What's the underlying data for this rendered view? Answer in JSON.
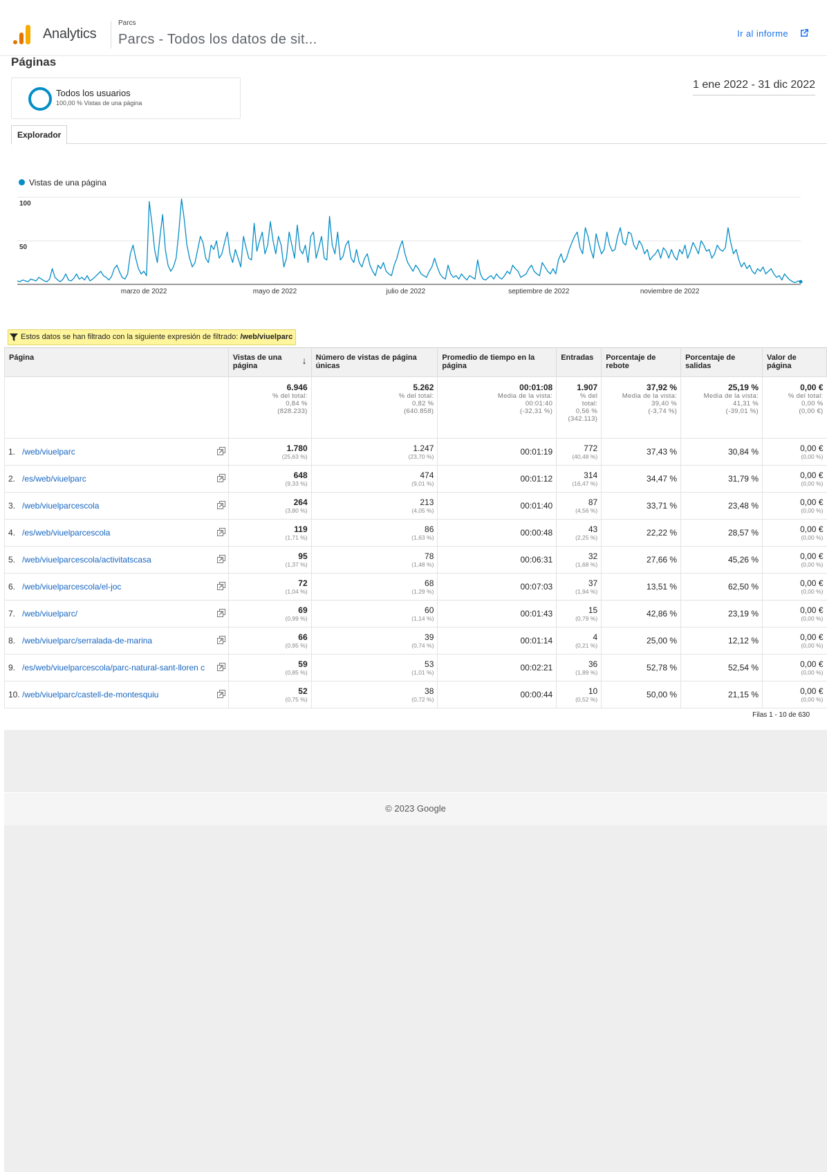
{
  "header": {
    "app_name": "Analytics",
    "property_small": "Parcs",
    "property_title": "Parcs - Todos los datos de sit...",
    "goto_report": "Ir al informe"
  },
  "page": {
    "title": "Páginas",
    "segment_name": "Todos los usuarios",
    "segment_sub": "100,00 % Vistas de una página",
    "date_range": "1 ene 2022 - 31 dic 2022",
    "tab_explorer": "Explorador"
  },
  "chart_data": {
    "type": "line",
    "series": [
      {
        "name": "Vistas de una página",
        "color": "#058dc7",
        "values": [
          4,
          3,
          5,
          4,
          3,
          6,
          5,
          4,
          8,
          6,
          4,
          3,
          6,
          18,
          8,
          5,
          3,
          6,
          12,
          5,
          4,
          7,
          12,
          6,
          8,
          5,
          10,
          4,
          6,
          9,
          12,
          15,
          10,
          8,
          5,
          9,
          18,
          22,
          14,
          8,
          6,
          12,
          35,
          45,
          30,
          18,
          12,
          15,
          10,
          95,
          70,
          40,
          25,
          55,
          80,
          40,
          22,
          15,
          20,
          30,
          60,
          98,
          75,
          45,
          30,
          20,
          25,
          40,
          55,
          48,
          30,
          25,
          45,
          40,
          50,
          30,
          35,
          48,
          60,
          35,
          25,
          40,
          30,
          20,
          55,
          42,
          30,
          28,
          70,
          38,
          50,
          60,
          35,
          45,
          72,
          50,
          35,
          55,
          45,
          20,
          30,
          60,
          45,
          30,
          68,
          40,
          35,
          45,
          25,
          55,
          60,
          30,
          42,
          55,
          30,
          28,
          78,
          45,
          35,
          60,
          28,
          32,
          45,
          50,
          30,
          25,
          40,
          25,
          20,
          30,
          35,
          22,
          15,
          10,
          22,
          18,
          25,
          15,
          12,
          10,
          22,
          30,
          42,
          50,
          35,
          25,
          20,
          15,
          22,
          18,
          12,
          10,
          8,
          15,
          20,
          30,
          20,
          12,
          8,
          6,
          22,
          12,
          8,
          10,
          6,
          12,
          8,
          5,
          10,
          8,
          6,
          28,
          12,
          6,
          5,
          8,
          10,
          6,
          12,
          8,
          6,
          10,
          15,
          12,
          22,
          18,
          15,
          8,
          10,
          12,
          18,
          22,
          15,
          12,
          10,
          25,
          20,
          15,
          12,
          18,
          12,
          28,
          35,
          25,
          30,
          40,
          48,
          55,
          60,
          42,
          35,
          65,
          55,
          40,
          30,
          58,
          45,
          35,
          40,
          60,
          45,
          38,
          40,
          55,
          65,
          48,
          45,
          60,
          58,
          45,
          40,
          50,
          45,
          35,
          40,
          28,
          32,
          35,
          40,
          30,
          42,
          38,
          30,
          40,
          32,
          28,
          40,
          35,
          45,
          30,
          38,
          48,
          42,
          35,
          50,
          45,
          38,
          40,
          30,
          35,
          45,
          40,
          38,
          42,
          65,
          48,
          35,
          40,
          28,
          20,
          25,
          18,
          22,
          15,
          12,
          18,
          15,
          20,
          12,
          15,
          18,
          12,
          8,
          10,
          5,
          12,
          8,
          5,
          3,
          2,
          4,
          3
        ]
      }
    ],
    "x_labels": [
      "marzo de 2022",
      "mayo de 2022",
      "julio de 2022",
      "septiembre de 2022",
      "noviembre de 2022"
    ],
    "y_ticks": [
      "100",
      "50"
    ],
    "ylim": [
      0,
      100
    ],
    "grid": true,
    "legend": "top-left"
  },
  "filter": {
    "text": "Estos datos se han filtrado con la siguiente expresión de filtrado:",
    "expression": "/web/viuelparc"
  },
  "table": {
    "headers": {
      "page": "Página",
      "views": "Vistas de una página",
      "unique": "Número de vistas de página únicas",
      "avg_time": "Promedio de tiempo en la página",
      "entries": "Entradas",
      "bounce": "Porcentaje de rebote",
      "exits": "Porcentaje de salidas",
      "value": "Valor de página"
    },
    "totals": {
      "views": {
        "main": "6.946",
        "l1": "% del total:",
        "l2": "0,84 %",
        "l3": "(828.233)"
      },
      "unique": {
        "main": "5.262",
        "l1": "% del total:",
        "l2": "0,82 %",
        "l3": "(640.858)"
      },
      "avg_time": {
        "main": "00:01:08",
        "l1": "Media de la vista:",
        "l2": "00:01:40",
        "l3": "(-32,31 %)"
      },
      "entries": {
        "main": "1.907",
        "l1": "% del",
        "l2": "total:",
        "l3": "0,56 %",
        "l4": "(342.113)"
      },
      "bounce": {
        "main": "37,92 %",
        "l1": "Media de la vista:",
        "l2": "39,40 %",
        "l3": "(-3,74 %)"
      },
      "exits": {
        "main": "25,19 %",
        "l1": "Media de la vista:",
        "l2": "41,31 %",
        "l3": "(-39,01 %)"
      },
      "value": {
        "main": "0,00 €",
        "l1": "% del total:",
        "l2": "0,00 %",
        "l3": "(0,00 €)"
      }
    },
    "rows": [
      {
        "rank": "1.",
        "page": "/web/viuelparc",
        "views": "1.780",
        "views_pct": "(25,63 %)",
        "unique": "1.247",
        "unique_pct": "(23,70 %)",
        "avg_time": "00:01:19",
        "entries": "772",
        "entries_pct": "(40,48 %)",
        "bounce": "37,43 %",
        "exits": "30,84 %",
        "value": "0,00 €",
        "value_pct": "(0,00 %)"
      },
      {
        "rank": "2.",
        "page": "/es/web/viuelparc",
        "views": "648",
        "views_pct": "(9,33 %)",
        "unique": "474",
        "unique_pct": "(9,01 %)",
        "avg_time": "00:01:12",
        "entries": "314",
        "entries_pct": "(16,47 %)",
        "bounce": "34,47 %",
        "exits": "31,79 %",
        "value": "0,00 €",
        "value_pct": "(0,00 %)"
      },
      {
        "rank": "3.",
        "page": "/web/viuelparcescola",
        "views": "264",
        "views_pct": "(3,80 %)",
        "unique": "213",
        "unique_pct": "(4,05 %)",
        "avg_time": "00:01:40",
        "entries": "87",
        "entries_pct": "(4,56 %)",
        "bounce": "33,71 %",
        "exits": "23,48 %",
        "value": "0,00 €",
        "value_pct": "(0,00 %)"
      },
      {
        "rank": "4.",
        "page": "/es/web/viuelparcescola",
        "views": "119",
        "views_pct": "(1,71 %)",
        "unique": "86",
        "unique_pct": "(1,63 %)",
        "avg_time": "00:00:48",
        "entries": "43",
        "entries_pct": "(2,25 %)",
        "bounce": "22,22 %",
        "exits": "28,57 %",
        "value": "0,00 €",
        "value_pct": "(0,00 %)"
      },
      {
        "rank": "5.",
        "page": "/web/viuelparcescola/activitatscasa",
        "views": "95",
        "views_pct": "(1,37 %)",
        "unique": "78",
        "unique_pct": "(1,48 %)",
        "avg_time": "00:06:31",
        "entries": "32",
        "entries_pct": "(1,68 %)",
        "bounce": "27,66 %",
        "exits": "45,26 %",
        "value": "0,00 €",
        "value_pct": "(0,00 %)"
      },
      {
        "rank": "6.",
        "page": "/web/viuelparcescola/el-joc",
        "views": "72",
        "views_pct": "(1,04 %)",
        "unique": "68",
        "unique_pct": "(1,29 %)",
        "avg_time": "00:07:03",
        "entries": "37",
        "entries_pct": "(1,94 %)",
        "bounce": "13,51 %",
        "exits": "62,50 %",
        "value": "0,00 €",
        "value_pct": "(0,00 %)"
      },
      {
        "rank": "7.",
        "page": "/web/viuelparc/",
        "views": "69",
        "views_pct": "(0,99 %)",
        "unique": "60",
        "unique_pct": "(1,14 %)",
        "avg_time": "00:01:43",
        "entries": "15",
        "entries_pct": "(0,79 %)",
        "bounce": "42,86 %",
        "exits": "23,19 %",
        "value": "0,00 €",
        "value_pct": "(0,00 %)"
      },
      {
        "rank": "8.",
        "page": "/web/viuelparc/serralada-de-marina",
        "views": "66",
        "views_pct": "(0,95 %)",
        "unique": "39",
        "unique_pct": "(0,74 %)",
        "avg_time": "00:01:14",
        "entries": "4",
        "entries_pct": "(0,21 %)",
        "bounce": "25,00 %",
        "exits": "12,12 %",
        "value": "0,00 €",
        "value_pct": "(0,00 %)"
      },
      {
        "rank": "9.",
        "page": "/es/web/viuelparcescola/parc-natural-sant-lloren c",
        "views": "59",
        "views_pct": "(0,85 %)",
        "unique": "53",
        "unique_pct": "(1,01 %)",
        "avg_time": "00:02:21",
        "entries": "36",
        "entries_pct": "(1,89 %)",
        "bounce": "52,78 %",
        "exits": "52,54 %",
        "value": "0,00 €",
        "value_pct": "(0,00 %)"
      },
      {
        "rank": "10.",
        "page": "/web/viuelparc/castell-de-montesquiu",
        "views": "52",
        "views_pct": "(0,75 %)",
        "unique": "38",
        "unique_pct": "(0,72 %)",
        "avg_time": "00:00:44",
        "entries": "10",
        "entries_pct": "(0,52 %)",
        "bounce": "50,00 %",
        "exits": "21,15 %",
        "value": "0,00 €",
        "value_pct": "(0,00 %)"
      }
    ],
    "rows_info": "Filas 1 - 10 de 630"
  },
  "footer": {
    "copyright": "© 2023 Google"
  },
  "colors": {
    "accent": "#058dc7",
    "link": "#1565c0",
    "filter_bg": "#fff59d"
  }
}
